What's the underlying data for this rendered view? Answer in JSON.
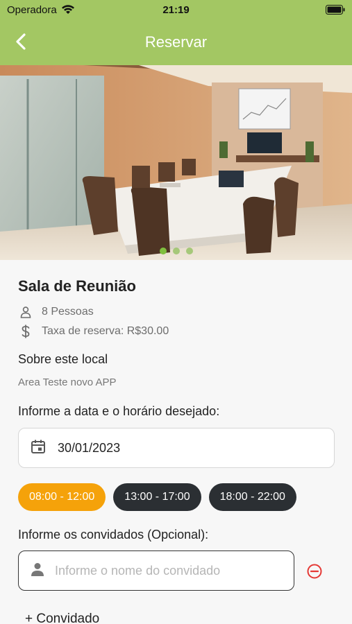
{
  "status_bar": {
    "carrier": "Operadora",
    "time": "21:19"
  },
  "nav": {
    "title": "Reservar"
  },
  "carousel": {
    "page_count": 3,
    "active_index": 0
  },
  "room": {
    "name": "Sala de Reunião",
    "capacity": "8 Pessoas",
    "fee": "Taxa de reserva: R$30.00"
  },
  "about": {
    "heading": "Sobre este local",
    "description": "Area Teste novo APP"
  },
  "schedule": {
    "heading": "Informe a data e o horário desejado:",
    "date": "30/01/2023",
    "slots": [
      "08:00 - 12:00",
      "13:00 - 17:00",
      "18:00 - 22:00"
    ],
    "selected_slot": "08:00 - 12:00"
  },
  "guests": {
    "heading": "Informe os convidados (Opcional):",
    "placeholder": "Informe o nome do convidado",
    "add_label": "+ Convidado"
  },
  "colors": {
    "header": "#a3c763",
    "selected_slot": "#f5a20a",
    "slot": "#2b2f33",
    "remove": "#e53935"
  }
}
